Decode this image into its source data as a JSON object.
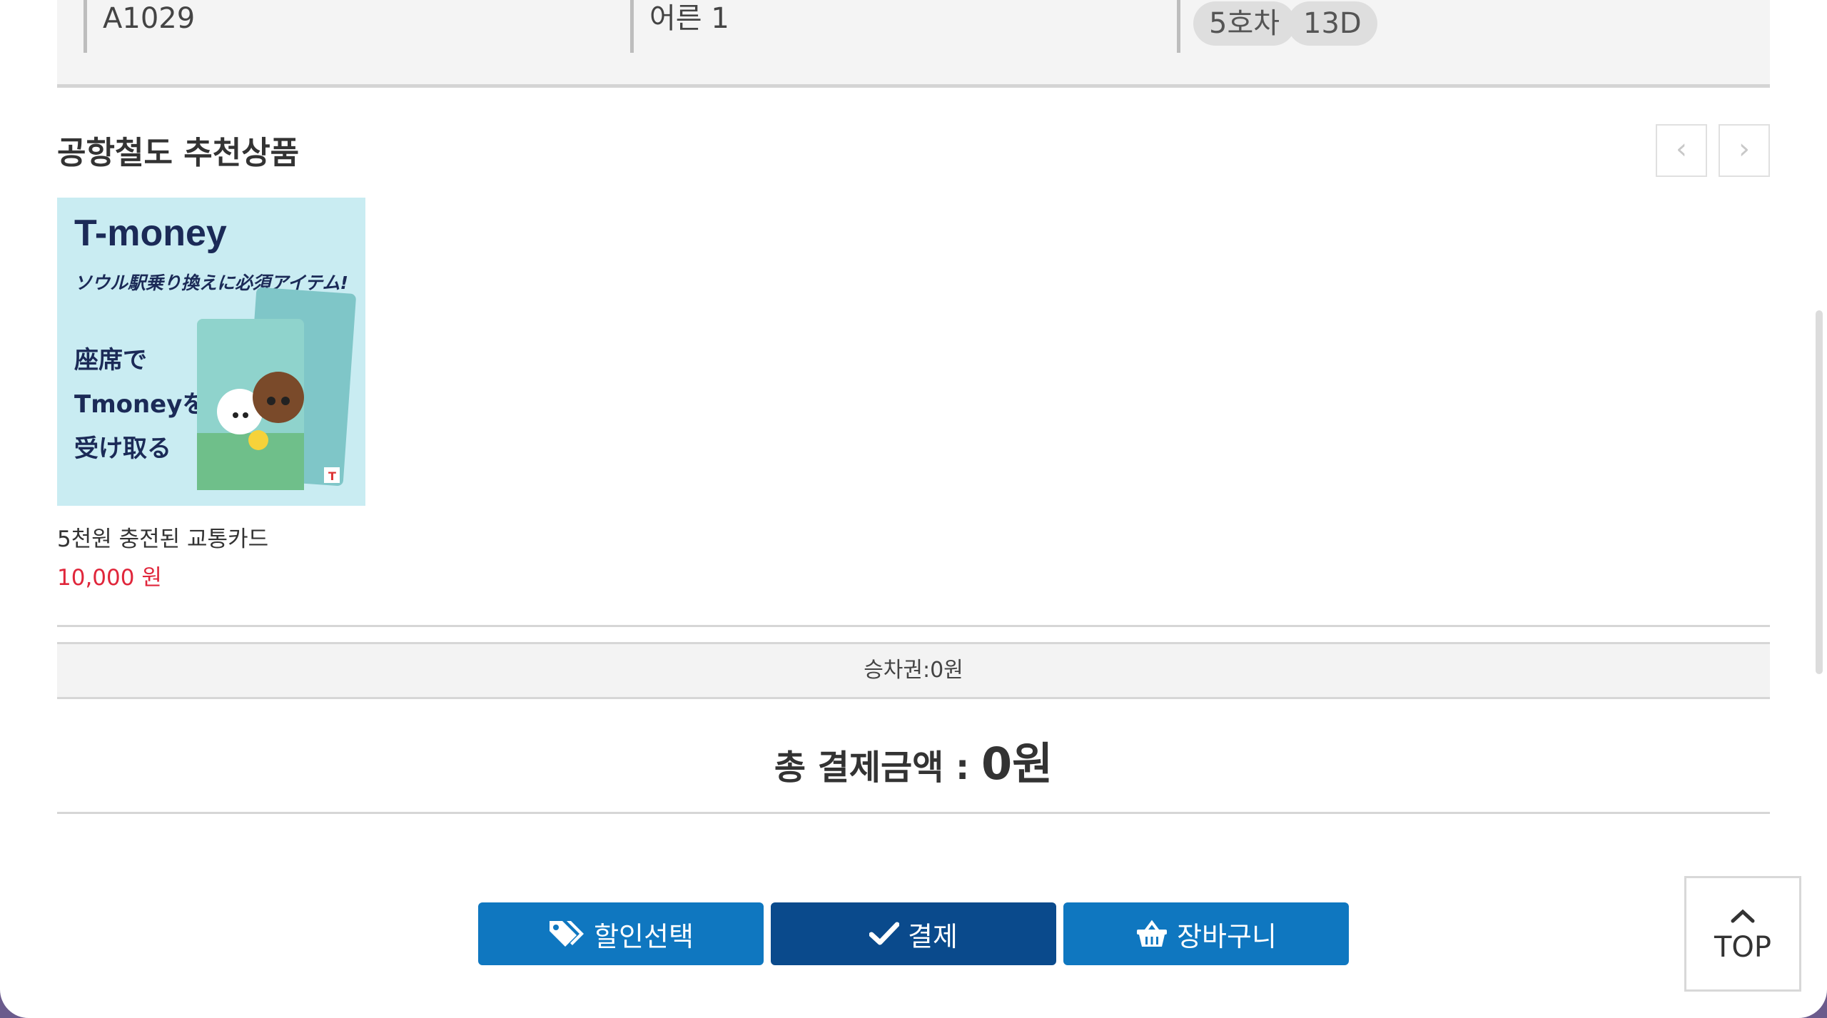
{
  "ticket_info": {
    "train_no": "A1029",
    "passengers": "어른 1",
    "car": "5호차",
    "seat": "13D"
  },
  "recommend": {
    "title": "공항철도 추천상품",
    "prev_icon": "chevron-left-icon",
    "next_icon": "chevron-right-icon",
    "products": [
      {
        "image_title": "T-money",
        "image_subtitle": "ソウル駅乗り換えに必須アイテム!",
        "image_line1": "座席で",
        "image_line2": "Tmoneyを",
        "image_line3": "受け取る",
        "name": "5천원 충전된 교통카드",
        "price": "10,000 원"
      }
    ]
  },
  "summary": {
    "ticket_line": "승차권:0원",
    "total_label": "총 결제금액 : ",
    "total_amount": "0원"
  },
  "actions": {
    "discount": "할인선택",
    "pay": "결제",
    "cart": "장바구니"
  },
  "top_button": {
    "label": "TOP"
  },
  "colors": {
    "accent_blue": "#0f77c0",
    "accent_navy": "#0a4a8c",
    "price_red": "#e0263b"
  }
}
